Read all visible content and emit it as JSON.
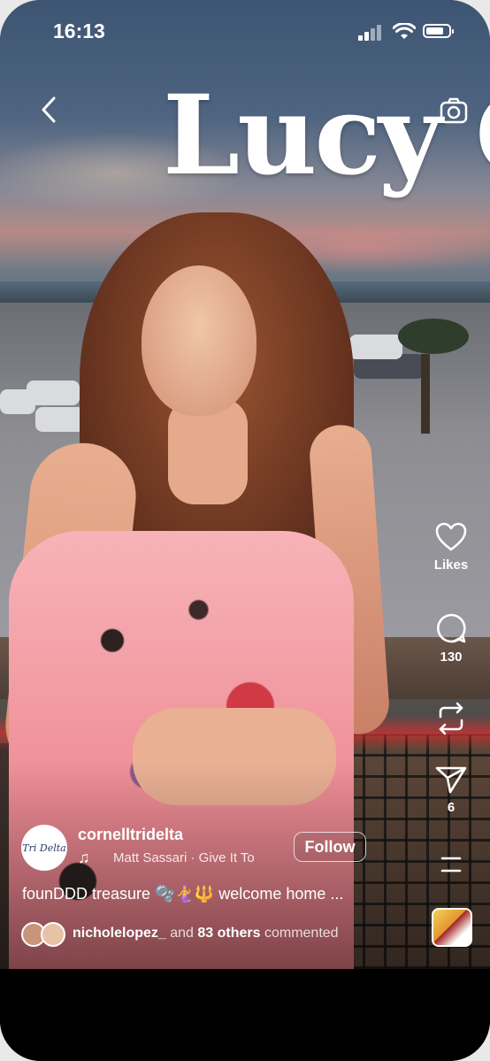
{
  "status_bar": {
    "time": "16:13",
    "battery_level": 0.8
  },
  "overlay_text": "Lucy C",
  "actions": {
    "likes_label": "Likes",
    "comments_count": "130",
    "shares_count": "6"
  },
  "post": {
    "author_avatar_text": "Tri Delta",
    "username": "cornelltridelta",
    "music": "Matt Sassari · Give It To",
    "follow_label": "Follow",
    "caption": "founDDD treasure 🫧🧜‍♀️🔱 welcome home ...",
    "comments_user": "nicholelopez_",
    "comments_mid": " and ",
    "comments_others": "83 others",
    "comments_tail": " commented"
  },
  "icons": [
    "back-chevron-icon",
    "camera-icon",
    "heart-icon",
    "comment-icon",
    "repost-icon",
    "send-icon",
    "more-icon",
    "music-note-icon"
  ]
}
